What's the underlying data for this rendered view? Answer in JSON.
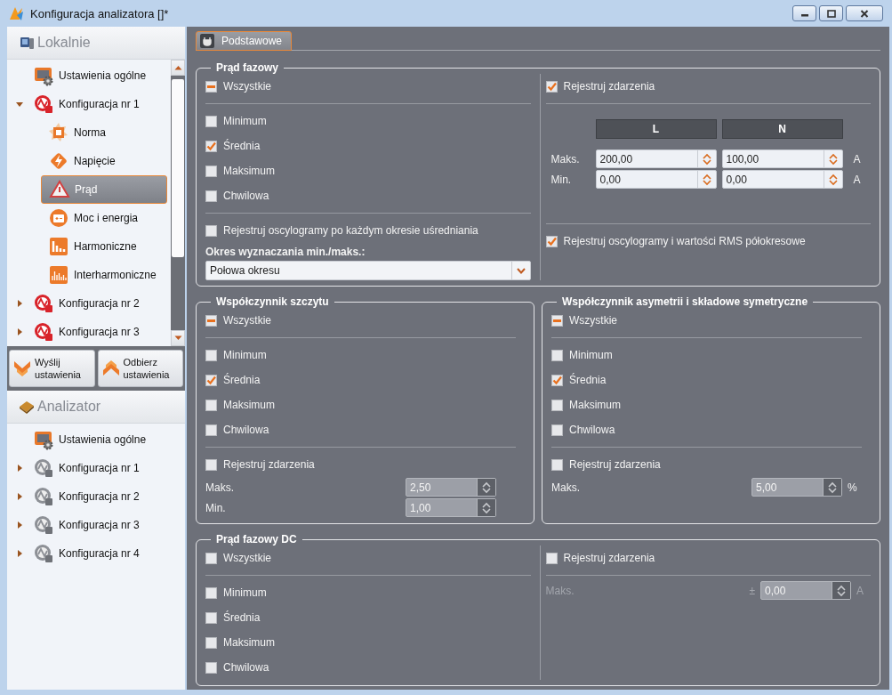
{
  "window": {
    "title": "Konfiguracja analizatora []*"
  },
  "sidebar": {
    "local": {
      "title": "Lokalnie",
      "items": [
        {
          "label": "Ustawienia ogólne",
          "kind": "general",
          "selected": false
        },
        {
          "label": "Konfiguracja nr 1",
          "kind": "config",
          "selected": false,
          "expanded": true,
          "children": [
            {
              "label": "Norma",
              "kind": "standard",
              "selected": false
            },
            {
              "label": "Napięcie",
              "kind": "voltage",
              "selected": false
            },
            {
              "label": "Prąd",
              "kind": "current",
              "selected": true
            },
            {
              "label": "Moc i energia",
              "kind": "power",
              "selected": false
            },
            {
              "label": "Harmoniczne",
              "kind": "harmonics",
              "selected": false
            },
            {
              "label": "Interharmoniczne",
              "kind": "interharmonics",
              "selected": false
            }
          ]
        },
        {
          "label": "Konfiguracja nr 2",
          "kind": "config",
          "selected": false,
          "expanded": false
        },
        {
          "label": "Konfiguracja nr 3",
          "kind": "config",
          "selected": false,
          "expanded": false
        }
      ]
    },
    "buttons": [
      {
        "label": "Wyślij ustawienia",
        "kind": "send"
      },
      {
        "label": "Odbierz ustawienia",
        "kind": "receive"
      }
    ],
    "device": {
      "title": "Analizator",
      "items": [
        {
          "label": "Ustawienia ogólne",
          "kind": "general",
          "selected": false
        },
        {
          "label": "Konfiguracja nr 1",
          "kind": "config_grey",
          "selected": false,
          "expanded": false
        },
        {
          "label": "Konfiguracja nr 2",
          "kind": "config_grey",
          "selected": false,
          "expanded": false
        },
        {
          "label": "Konfiguracja nr 3",
          "kind": "config_grey",
          "selected": false,
          "expanded": false
        },
        {
          "label": "Konfiguracja nr 4",
          "kind": "config_grey",
          "selected": false,
          "expanded": false
        }
      ]
    }
  },
  "main": {
    "tabs": [
      {
        "label": "Podstawowe",
        "selected": true
      }
    ],
    "sections": [
      {
        "title": "Prąd fazowy",
        "columns": [
          [
            {
              "kind": "select_all",
              "label": "Wszystkie",
              "mixed": true
            },
            {
              "kind": "separator"
            },
            {
              "kind": "checkbox",
              "label": "Minimum",
              "checked": false
            },
            {
              "kind": "checkbox",
              "label": "Średnia",
              "checked": true
            },
            {
              "kind": "checkbox",
              "label": "Maksimum",
              "checked": false
            },
            {
              "kind": "checkbox",
              "label": "Chwilowa",
              "checked": false
            },
            {
              "kind": "separator"
            },
            {
              "kind": "checkbox",
              "label": "Rejestruj oscylogramy po każdym okresie uśredniania",
              "checked": false
            },
            {
              "kind": "heading",
              "text": "Okres wyznaczania min./maks.:"
            },
            {
              "kind": "dropdown",
              "value": "Połowa okresu"
            }
          ],
          [
            {
              "kind": "checkbox",
              "label": "Rejestruj zdarzenia",
              "checked": true
            },
            {
              "kind": "separator"
            },
            {
              "kind": "spin_grid",
              "columns": [
                "L",
                "N"
              ],
              "rows": [
                {
                  "label": "Maks.",
                  "values": [
                    "200,00",
                    "100,00"
                  ],
                  "unit": "A"
                },
                {
                  "label": "Min.",
                  "values": [
                    "0,00",
                    "0,00"
                  ],
                  "unit": "A"
                }
              ]
            },
            {
              "kind": "separator"
            },
            {
              "kind": "checkbox",
              "label": "Rejestruj oscylogramy i wartości RMS półokresowe",
              "checked": true
            }
          ]
        ]
      },
      {
        "title": "Współczynnik szczytu",
        "columns": [
          [
            {
              "kind": "select_all",
              "label": "Wszystkie",
              "mixed": true
            },
            {
              "kind": "separator"
            },
            {
              "kind": "checkbox",
              "label": "Minimum",
              "checked": false
            },
            {
              "kind": "checkbox",
              "label": "Średnia",
              "checked": true
            },
            {
              "kind": "checkbox",
              "label": "Maksimum",
              "checked": false
            },
            {
              "kind": "checkbox",
              "label": "Chwilowa",
              "checked": false
            },
            {
              "kind": "separator"
            },
            {
              "kind": "checkbox",
              "label": "Rejestruj zdarzenia",
              "checked": false
            },
            {
              "kind": "spin",
              "label": "Maks.",
              "value": "2,50",
              "disabled": true,
              "label_greyed": false
            },
            {
              "kind": "spin",
              "label": "Min.",
              "value": "1,00",
              "disabled": true,
              "label_greyed": false
            }
          ]
        ]
      },
      {
        "title": "Współczynnik asymetrii i składowe symetryczne",
        "columns": [
          [
            {
              "kind": "select_all",
              "label": "Wszystkie",
              "mixed": true
            },
            {
              "kind": "separator"
            },
            {
              "kind": "checkbox",
              "label": "Minimum",
              "checked": false
            },
            {
              "kind": "checkbox",
              "label": "Średnia",
              "checked": true
            },
            {
              "kind": "checkbox",
              "label": "Maksimum",
              "checked": false
            },
            {
              "kind": "checkbox",
              "label": "Chwilowa",
              "checked": false
            },
            {
              "kind": "separator"
            },
            {
              "kind": "checkbox",
              "label": "Rejestruj zdarzenia",
              "checked": false
            },
            {
              "kind": "spin",
              "label": "Maks.",
              "value": "5,00",
              "unit": "%",
              "disabled": true,
              "label_greyed": false
            }
          ]
        ]
      },
      {
        "title": "Prąd fazowy DC",
        "columns": [
          [
            {
              "kind": "select_all",
              "label": "Wszystkie",
              "mixed": false
            },
            {
              "kind": "separator"
            },
            {
              "kind": "checkbox",
              "label": "Minimum",
              "checked": false
            },
            {
              "kind": "checkbox",
              "label": "Średnia",
              "checked": false
            },
            {
              "kind": "checkbox",
              "label": "Maksimum",
              "checked": false
            },
            {
              "kind": "checkbox",
              "label": "Chwilowa",
              "checked": false
            }
          ],
          [
            {
              "kind": "checkbox",
              "label": "Rejestruj zdarzenia",
              "checked": false
            },
            {
              "kind": "separator"
            },
            {
              "kind": "spin",
              "label": "Maks.",
              "sign": "±",
              "value": "0,00",
              "unit": "A",
              "disabled": true,
              "label_greyed": true
            }
          ]
        ]
      }
    ]
  }
}
